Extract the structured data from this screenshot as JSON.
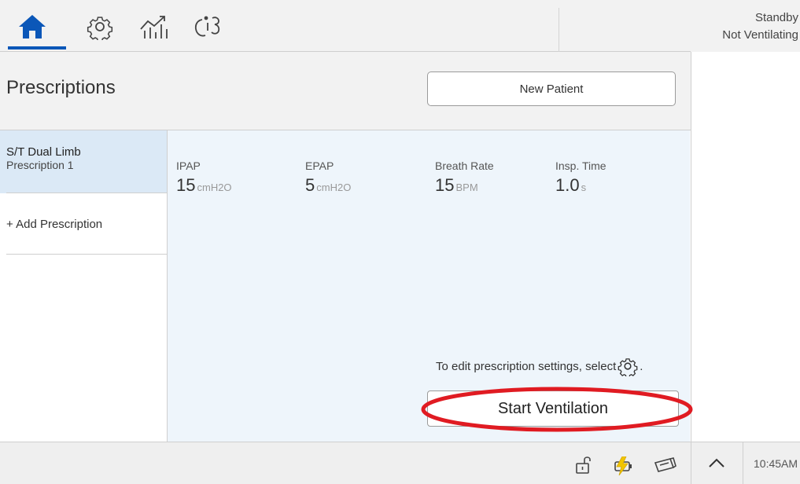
{
  "status": {
    "line1": "Standby",
    "line2": "Not Ventilating"
  },
  "tabs": [
    {
      "name": "home",
      "selected": true
    },
    {
      "name": "settings"
    },
    {
      "name": "monitoring"
    },
    {
      "name": "tools"
    }
  ],
  "header": {
    "title": "Prescriptions",
    "new_patient_label": "New Patient"
  },
  "prescriptions": {
    "items": [
      {
        "mode": "S/T  Dual Limb",
        "name": "Prescription 1",
        "selected": true
      }
    ],
    "add_label": "+ Add Prescription"
  },
  "params": [
    {
      "label": "IPAP",
      "value": "15",
      "unit": "cmH2O"
    },
    {
      "label": "EPAP",
      "value": "5",
      "unit": "cmH2O"
    },
    {
      "label": "Breath Rate",
      "value": "15",
      "unit": "BPM"
    },
    {
      "label": "Insp. Time",
      "value": "1.0",
      "unit": "s"
    }
  ],
  "hint": {
    "text": "To edit prescription settings, select",
    "suffix": "."
  },
  "start_label": "Start Ventilation",
  "footer": {
    "time": "10:45AM"
  },
  "colors": {
    "accent": "#0b57b8",
    "selected_bg": "#dbe9f6",
    "panel_bg": "#eef5fb",
    "highlight": "#e01b22"
  },
  "icons": [
    "home-icon",
    "gear-icon",
    "trend-chart-icon",
    "tools-icon",
    "unlock-icon",
    "ac-power-icon",
    "battery-icon",
    "chevron-up-icon"
  ]
}
